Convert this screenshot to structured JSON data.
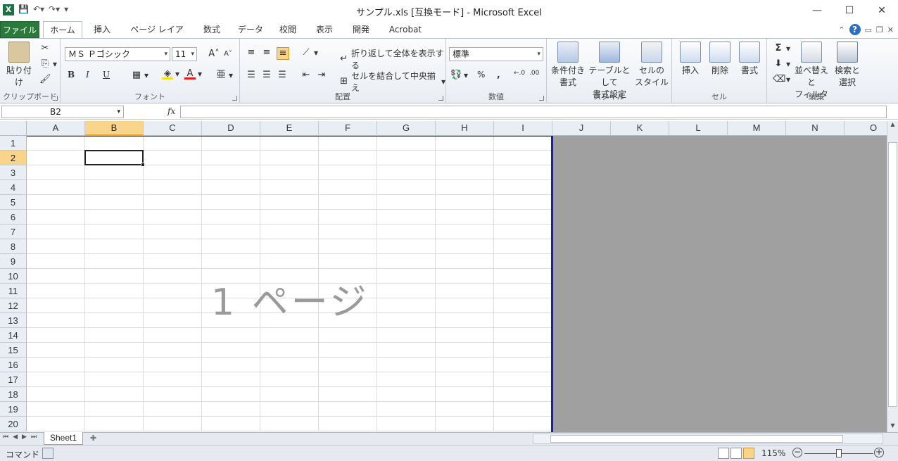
{
  "window": {
    "title": "サンプル.xls  [互換モード]  -  Microsoft Excel",
    "app_icon_letter": "X"
  },
  "tabs": {
    "file": "ファイル",
    "items": [
      "ホーム",
      "挿入",
      "ページ レイアウト",
      "数式",
      "データ",
      "校閲",
      "表示",
      "開発",
      "Acrobat"
    ],
    "active": "ホーム"
  },
  "ribbon": {
    "clipboard": {
      "paste": "貼り付け",
      "label": "クリップボード"
    },
    "font": {
      "name": "ＭＳ Ｐゴシック",
      "size": "11",
      "label": "フォント",
      "bold": "B",
      "italic": "I",
      "underline": "U"
    },
    "alignment": {
      "wrap_text": "折り返して全体を表示する",
      "merge_center": "セルを結合して中央揃え",
      "label": "配置"
    },
    "number": {
      "format": "標準",
      "label": "数値",
      "percent": "%",
      "comma": ","
    },
    "styles": {
      "conditional": [
        "条件付き",
        "書式"
      ],
      "table": [
        "テーブルとして",
        "書式設定"
      ],
      "cell_styles": [
        "セルの",
        "スタイル"
      ],
      "label": "スタイル"
    },
    "cells": {
      "insert": "挿入",
      "delete": "削除",
      "format": "書式",
      "label": "セル"
    },
    "editing": {
      "sort_filter": [
        "並べ替えと",
        "フィルター"
      ],
      "find_select": [
        "検索と",
        "選択"
      ],
      "label": "編集"
    }
  },
  "formula_bar": {
    "name_box": "B2",
    "fx": "fx",
    "formula": ""
  },
  "sheet": {
    "columns": [
      "A",
      "B",
      "C",
      "D",
      "E",
      "F",
      "G",
      "H",
      "I",
      "J",
      "K",
      "L",
      "M",
      "N",
      "O"
    ],
    "rows": [
      "1",
      "2",
      "3",
      "4",
      "5",
      "6",
      "7",
      "8",
      "9",
      "10",
      "11",
      "12",
      "13",
      "14",
      "15",
      "16",
      "17",
      "18",
      "19",
      "20"
    ],
    "selected_column": "B",
    "selected_row": "2",
    "page_watermark": "1 ページ",
    "tabs": [
      "Sheet1"
    ]
  },
  "status_bar": {
    "mode": "コマンド",
    "zoom": "115%"
  }
}
